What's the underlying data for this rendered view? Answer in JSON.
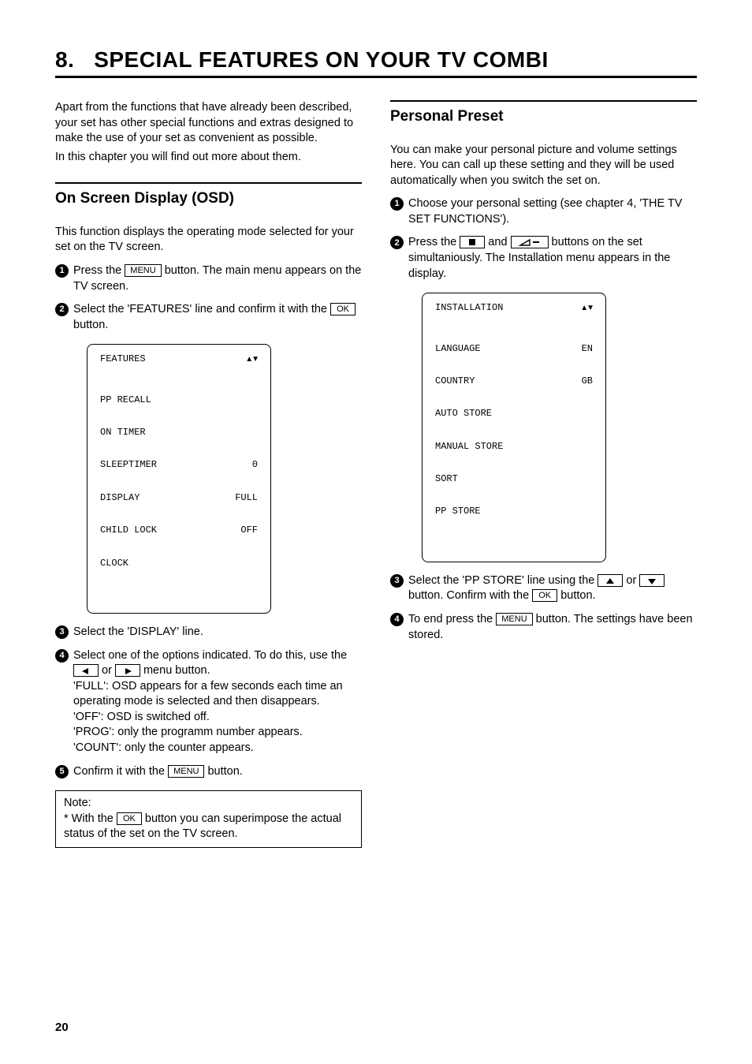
{
  "chapter": {
    "num": "8.",
    "title": "SPECIAL FEATURES ON YOUR TV COMBI"
  },
  "intro": {
    "p1": "Apart from the functions that have already been described, your set has other special functions and extras designed to make the use of your set as convenient as possible.",
    "p2": "In this chapter you will find out more about them."
  },
  "left": {
    "section_title": "On Screen Display (OSD)",
    "desc": "This function displays the operating mode selected for your set on the TV screen.",
    "step1_a": "Press the ",
    "step1_b": " button. The main menu appears on the TV screen.",
    "step2_a": "Select the 'FEATURES' line and confirm it with the ",
    "step2_b": " button.",
    "osd": {
      "title": "FEATURES",
      "rows": [
        {
          "l": "PP RECALL",
          "r": ""
        },
        {
          "l": "ON TIMER",
          "r": ""
        },
        {
          "l": "SLEEPTIMER",
          "r": "0"
        },
        {
          "l": "DISPLAY",
          "r": "FULL"
        },
        {
          "l": "CHILD LOCK",
          "r": "OFF"
        },
        {
          "l": "CLOCK",
          "r": ""
        }
      ]
    },
    "step3": "Select the 'DISPLAY' line.",
    "step4_a": "Select one of the options indicated. To do this, use the ",
    "step4_b": " or ",
    "step4_c": " menu button.",
    "step4_full": "'FULL': OSD appears for a few seconds each time an operating mode is selected and then disappears.",
    "step4_off": "'OFF': OSD is switched off.",
    "step4_prog": "'PROG': only the programm number appears.",
    "step4_count": "'COUNT': only the counter appears.",
    "step5_a": "Confirm it with the ",
    "step5_b": " button.",
    "note_label": "Note:",
    "note_a": "* With the ",
    "note_b": " button you can superimpose the actual status of the set on the TV screen."
  },
  "right": {
    "section_title": "Personal Preset",
    "desc": "You can make your personal picture and volume settings here. You can call up these setting and they will be used automatically when you switch the set on.",
    "step1": "Choose your personal setting (see chapter 4, 'THE TV SET FUNCTIONS').",
    "step2_a": "Press the ",
    "step2_b": " and ",
    "step2_c": " buttons on the set simultaniously. The Installation menu appears in the display.",
    "osd": {
      "title": "INSTALLATION",
      "rows": [
        {
          "l": "LANGUAGE",
          "r": "EN"
        },
        {
          "l": "COUNTRY",
          "r": "GB"
        },
        {
          "l": "AUTO STORE",
          "r": ""
        },
        {
          "l": "MANUAL STORE",
          "r": ""
        },
        {
          "l": "SORT",
          "r": ""
        },
        {
          "l": "PP STORE",
          "r": ""
        }
      ]
    },
    "step3_a": "Select the 'PP STORE' line using the ",
    "step3_b": " or ",
    "step3_c": " button. Confirm with the ",
    "step3_d": " button.",
    "step4_a": "To end press the ",
    "step4_b": " button. The settings have been stored."
  },
  "keys": {
    "menu": "MENU",
    "ok": "OK"
  },
  "page_number": "20"
}
